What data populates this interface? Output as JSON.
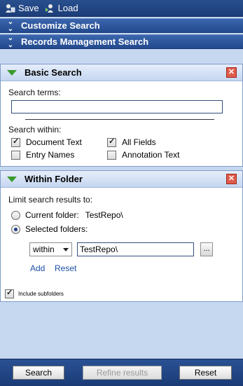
{
  "toolbar": {
    "save_label": "Save",
    "load_label": "Load"
  },
  "sections": {
    "customize": "Customize Search",
    "records": "Records Management Search"
  },
  "basic_search": {
    "title": "Basic Search",
    "close_glyph": "✕",
    "search_terms_label": "Search terms:",
    "search_terms_value": "",
    "search_within_label": "Search within:",
    "options": {
      "document_text": "Document Text",
      "all_fields": "All Fields",
      "entry_names": "Entry Names",
      "annotation_text": "Annotation Text"
    }
  },
  "within_folder": {
    "title": "Within Folder",
    "close_glyph": "✕",
    "limit_label": "Limit search results to:",
    "current_folder_label": "Current folder:",
    "current_folder_value": "TestRepo\\",
    "selected_folders_label": "Selected folders:",
    "scope_select": "within",
    "folder_value": "TestRepo\\",
    "browse_label": "...",
    "add_link": "Add",
    "reset_link": "Reset",
    "include_subfolders": "Include subfolders"
  },
  "footer": {
    "search": "Search",
    "refine": "Refine results",
    "reset": "Reset"
  }
}
